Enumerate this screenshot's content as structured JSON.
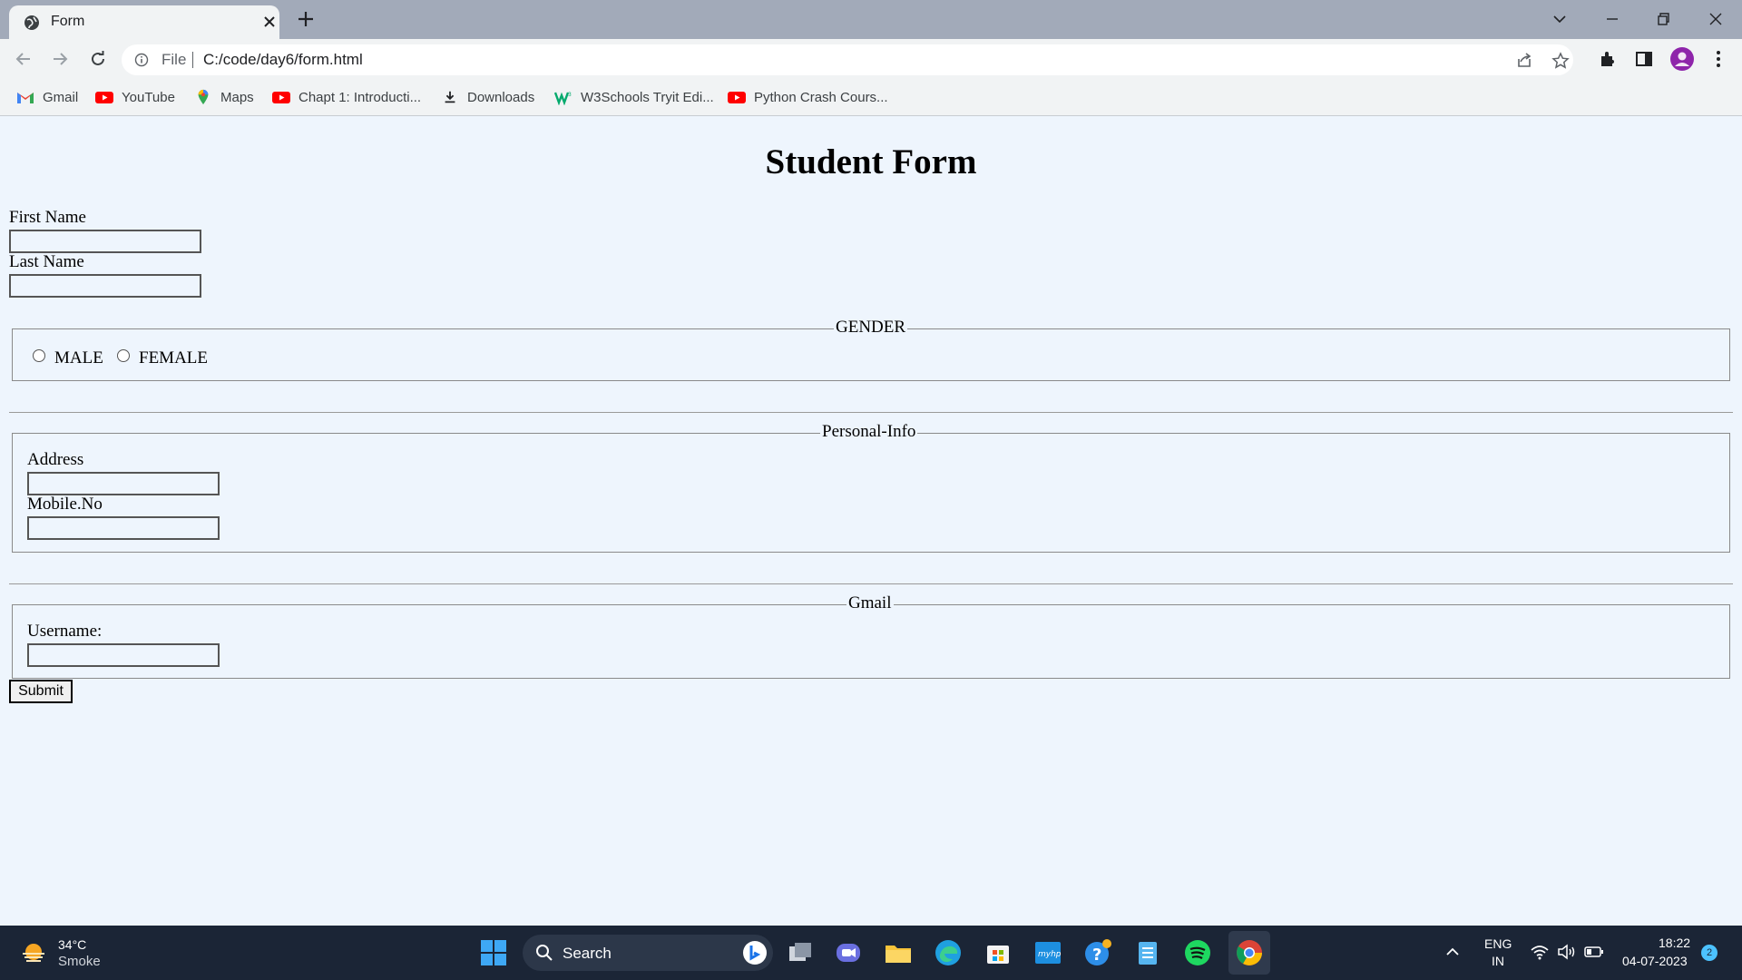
{
  "browser": {
    "tab_title": "Form",
    "omnibox_prefix": "File",
    "url": "C:/code/day6/form.html",
    "bookmarks": [
      {
        "label": "Gmail",
        "icon": "gmail-icon"
      },
      {
        "label": "YouTube",
        "icon": "youtube-icon"
      },
      {
        "label": "Maps",
        "icon": "maps-icon"
      },
      {
        "label": "Chapt 1: Introducti...",
        "icon": "youtube-icon"
      },
      {
        "label": "Downloads",
        "icon": "download-icon"
      },
      {
        "label": "W3Schools Tryit Edi...",
        "icon": "w3schools-icon"
      },
      {
        "label": "Python Crash Cours...",
        "icon": "youtube-icon"
      }
    ]
  },
  "form": {
    "title": "Student Form",
    "first_name_label": "First Name",
    "last_name_label": "Last Name",
    "gender": {
      "legend": "GENDER",
      "options": [
        "MALE",
        "FEMALE"
      ]
    },
    "personal_info": {
      "legend": "Personal-Info",
      "address_label": "Address",
      "mobile_label": "Mobile.No"
    },
    "gmail": {
      "legend": "Gmail",
      "username_label": "Username:"
    },
    "submit_label": "Submit"
  },
  "taskbar": {
    "weather_temp": "34°C",
    "weather_desc": "Smoke",
    "search_label": "Search",
    "lang_line1": "ENG",
    "lang_line2": "IN",
    "time": "18:22",
    "date": "04-07-2023",
    "notification_count": "2"
  },
  "colors": {
    "page_background": "#eef5fd",
    "tabstrip": "#a2aab9",
    "taskbar": "#1b2536"
  }
}
